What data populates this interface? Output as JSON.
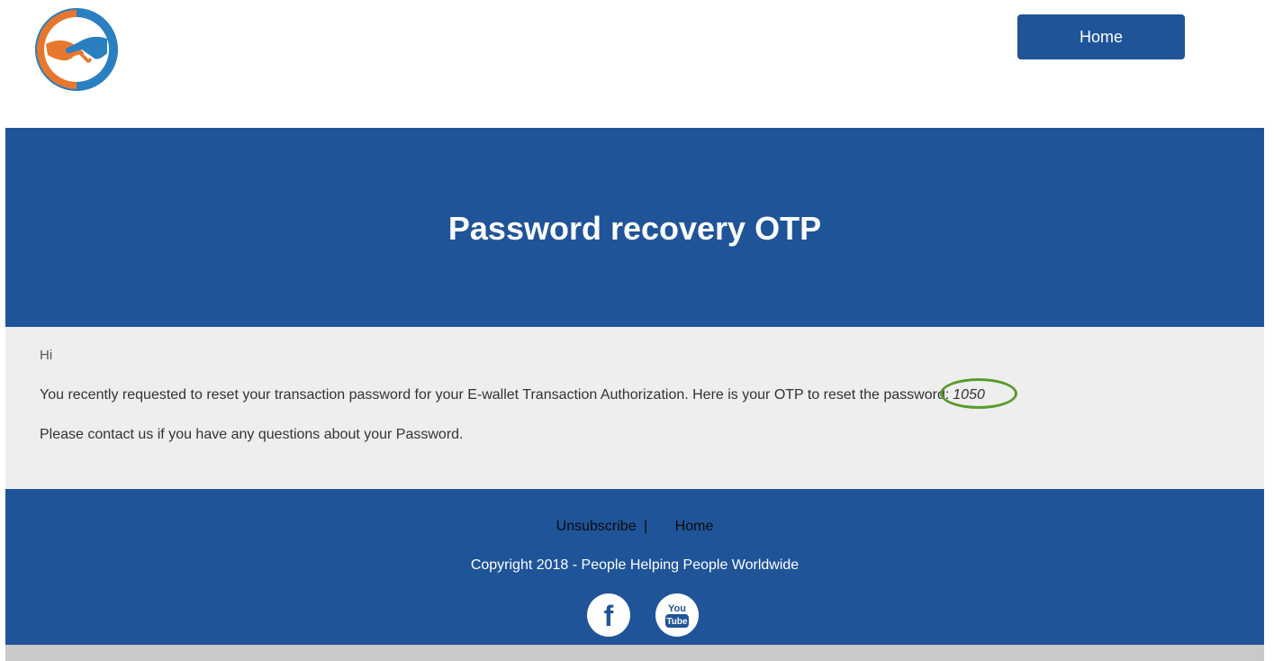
{
  "header": {
    "home_label": "Home"
  },
  "hero": {
    "title": "Password recovery OTP"
  },
  "content": {
    "greeting": "Hi",
    "body_text": "You recently requested to reset your transaction password for your E-wallet Transaction Authorization. Here is your OTP to reset the password:",
    "otp_code": "1050",
    "contact_text": "Please contact us if you have any questions about your Password."
  },
  "footer": {
    "unsubscribe_label": "Unsubscribe",
    "separator": "|",
    "home_label": "Home",
    "copyright": "Copyright 2018 - People Helping People Worldwide",
    "facebook_glyph": "f",
    "youtube_glyph_top": "You",
    "youtube_glyph_bottom": "Tube"
  },
  "icons": {
    "logo": "handshake-logo-icon",
    "facebook": "facebook-icon",
    "youtube": "youtube-icon"
  },
  "colors": {
    "brand_blue": "#1f5499",
    "content_bg": "#eeeeee",
    "logo_orange": "#e8772e",
    "logo_blue": "#2a7fc1",
    "otp_highlight": "#5a9a2e",
    "bottom_bar": "#c9c9c9"
  }
}
